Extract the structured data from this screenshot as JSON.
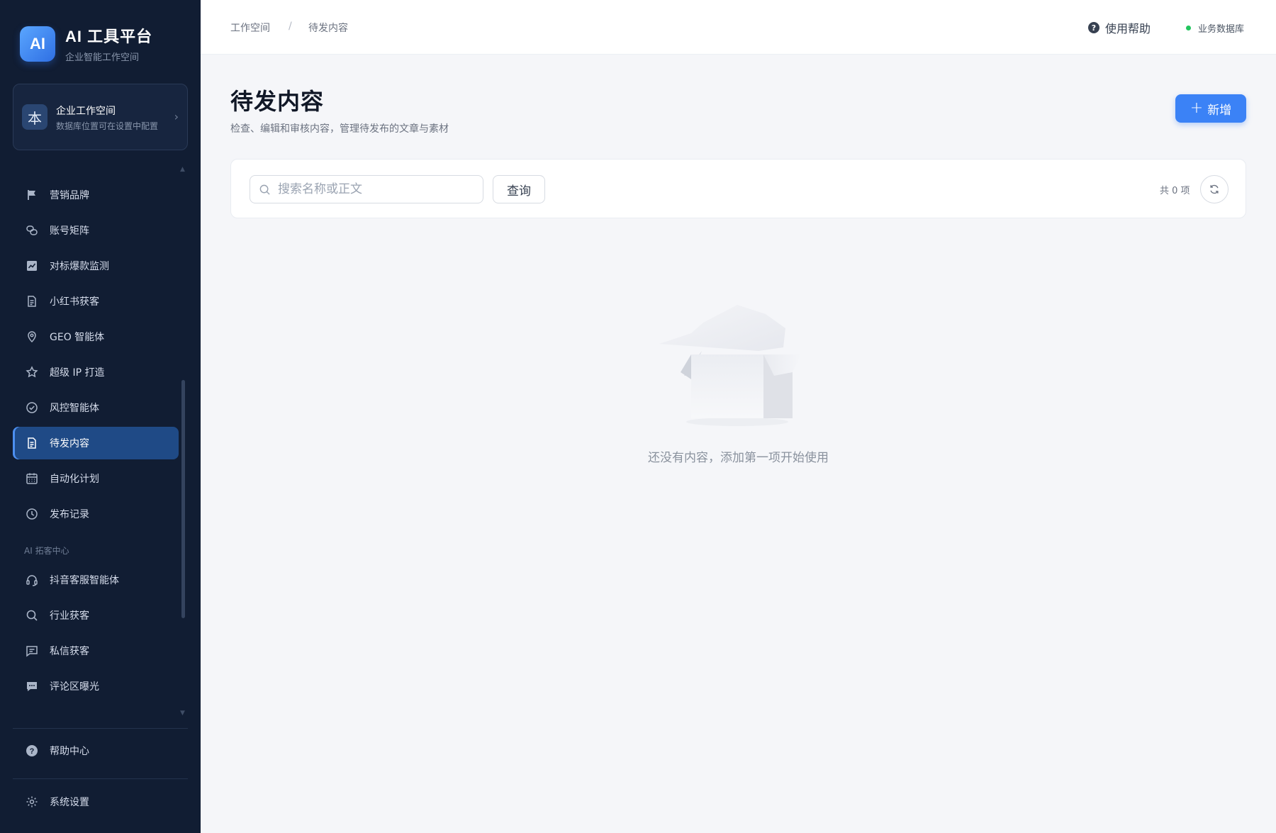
{
  "brand": {
    "logo_text": "AI",
    "title": "AI 工具平台",
    "subtitle": "企业智能工作空间"
  },
  "workspace": {
    "avatar": "本",
    "name": "企业工作空间",
    "desc": "数据库位置可在设置中配置"
  },
  "sidebar": {
    "items": [
      {
        "label": "营销品牌",
        "icon": "flag-icon"
      },
      {
        "label": "账号矩阵",
        "icon": "link-icon"
      },
      {
        "label": "对标爆款监测",
        "icon": "chart-icon"
      },
      {
        "label": "小红书获客",
        "icon": "document-icon"
      },
      {
        "label": "GEO 智能体",
        "icon": "location-pin-icon"
      },
      {
        "label": "超级 IP 打造",
        "icon": "star-icon"
      },
      {
        "label": "风控智能体",
        "icon": "check-circle-icon"
      },
      {
        "label": "待发内容",
        "icon": "document-icon",
        "active": true
      },
      {
        "label": "自动化计划",
        "icon": "calendar-icon"
      },
      {
        "label": "发布记录",
        "icon": "clock-icon"
      }
    ],
    "section_label": "AI 拓客中心",
    "section_items": [
      {
        "label": "抖音客服智能体",
        "icon": "headset-icon"
      },
      {
        "label": "行业获客",
        "icon": "search-icon"
      },
      {
        "label": "私信获客",
        "icon": "message-icon"
      },
      {
        "label": "评论区曝光",
        "icon": "comment-icon"
      }
    ],
    "help_label": "帮助中心",
    "settings_label": "系统设置"
  },
  "topbar": {
    "breadcrumb": [
      "工作空间",
      "待发内容"
    ],
    "breadcrumb_sep": "/",
    "help_label": "使用帮助",
    "db_label": "业务数据库",
    "db_status_color": "#22c55e"
  },
  "main": {
    "title": "待发内容",
    "description": "检查、编辑和审核内容，管理待发布的文章与素材",
    "add_label": "新增",
    "search_placeholder": "搜索名称或正文",
    "query_label": "查询",
    "count_text": "共 0 项",
    "empty_text": "还没有内容，添加第一项开始使用"
  },
  "colors": {
    "sidebar_bg": "#111d33",
    "accent": "#3b82f6",
    "active_item": "#1f4a86"
  }
}
